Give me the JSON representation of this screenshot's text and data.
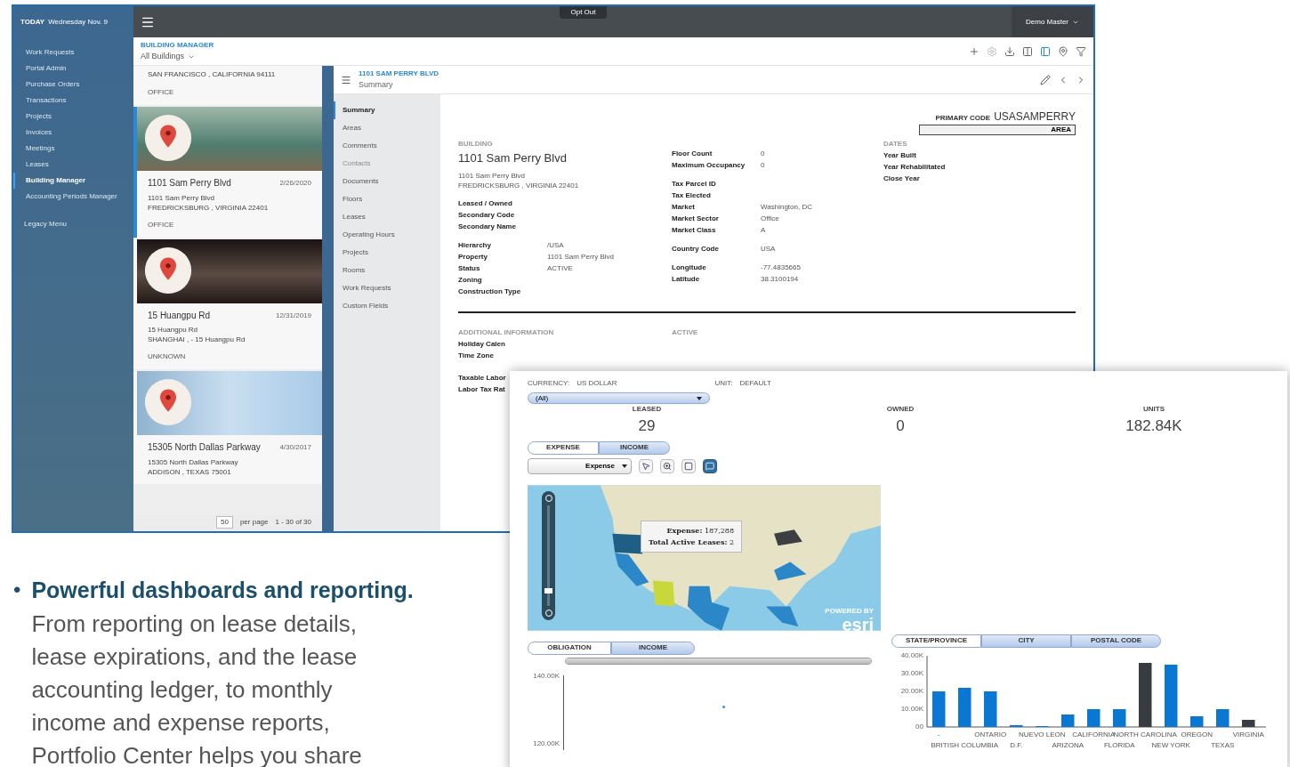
{
  "app": {
    "today_label": "TODAY",
    "date": "Wednesday Nov. 9",
    "opt_out": "Opt Out",
    "user": "Demo Master",
    "nav": [
      {
        "label": "Work Requests",
        "selected": false
      },
      {
        "label": "Portal Admin",
        "selected": false
      },
      {
        "label": "Purchase Orders",
        "selected": false
      },
      {
        "label": "Transactions",
        "selected": false
      },
      {
        "label": "Projects",
        "selected": false
      },
      {
        "label": "Invoices",
        "selected": false
      },
      {
        "label": "Meetings",
        "selected": false
      },
      {
        "label": "Leases",
        "selected": false
      },
      {
        "label": "Building Manager",
        "selected": true
      },
      {
        "label": "Accounting Periods Manager",
        "selected": false
      }
    ],
    "legacy": "Legacy Menu",
    "module": "BUILDING MANAGER",
    "scope": "All Buildings",
    "buildings": [
      {
        "kind": "partial",
        "lines": [
          "SAN FRANCISCO , CALIFORNIA 94111"
        ],
        "type": "OFFICE",
        "selected": false
      },
      {
        "kind": "card",
        "name": "1101 Sam Perry Blvd",
        "date": "2/26/2020",
        "lines": [
          "1101 Sam Perry Blvd",
          "FREDRICKSBURG , VIRGINIA 22401"
        ],
        "type": "OFFICE",
        "selected": true
      },
      {
        "kind": "card",
        "name": "15 Huangpu Rd",
        "date": "12/31/2019",
        "lines": [
          "15 Huangpu Rd",
          "SHANGHAI , - 15 Huangpu Rd"
        ],
        "type": "UNKNOWN",
        "selected": false
      },
      {
        "kind": "card",
        "name": "15305 North Dallas Parkway",
        "date": "4/30/2017",
        "lines": [
          "15305 North Dallas Parkway",
          "ADDISON , TEXAS 75001"
        ],
        "selected": false
      }
    ],
    "pager": {
      "per_page_value": "50",
      "per_page": "per page",
      "range": "1 - 30 of 30"
    },
    "detail": {
      "crumb": "1101 SAM PERRY BLVD",
      "section": "Summary",
      "sections": [
        {
          "label": "Summary",
          "selected": true,
          "disabled": false
        },
        {
          "label": "Areas",
          "selected": false,
          "disabled": false
        },
        {
          "label": "Comments",
          "selected": false,
          "disabled": false
        },
        {
          "label": "Contacts",
          "selected": false,
          "disabled": true
        },
        {
          "label": "Documents",
          "selected": false,
          "disabled": false
        },
        {
          "label": "Floors",
          "selected": false,
          "disabled": false
        },
        {
          "label": "Leases",
          "selected": false,
          "disabled": false
        },
        {
          "label": "Operating Hours",
          "selected": false,
          "disabled": false
        },
        {
          "label": "Projects",
          "selected": false,
          "disabled": false
        },
        {
          "label": "Rooms",
          "selected": false,
          "disabled": false
        },
        {
          "label": "Work Requests",
          "selected": false,
          "disabled": false
        },
        {
          "label": "Custom Fields",
          "selected": false,
          "disabled": false
        }
      ],
      "primary_code_label": "PRIMARY CODE",
      "primary_code": "USASAMPERRY",
      "area_label": "AREA",
      "building_heading": "BUILDING",
      "building_name": "1101 Sam Perry Blvd",
      "address": [
        "1101 Sam Perry Blvd",
        "FREDRICKSBURG , VIRGINIA 22401"
      ],
      "columns": [
        {
          "groups": [
            [
              {
                "label": "Leased / Owned"
              },
              {
                "label": "Secondary Code"
              },
              {
                "label": "Secondary Name"
              }
            ],
            [
              {
                "label": "Hierarchy",
                "value": "/USA"
              },
              {
                "label": "Property",
                "value": "1101 Sam Perry Blvd"
              },
              {
                "label": "Status",
                "value": "ACTIVE"
              },
              {
                "label": "Zoning"
              },
              {
                "label": "Construction Type"
              }
            ]
          ]
        },
        {
          "groups": [
            [
              {
                "label": "Floor Count",
                "value": "0"
              },
              {
                "label": "Maximum Occupancy",
                "value": "0"
              }
            ],
            [
              {
                "label": "Tax Parcel ID"
              },
              {
                "label": "Tax Elected"
              },
              {
                "label": "Market",
                "value": "Washington, DC"
              },
              {
                "label": "Market Sector",
                "value": "Office"
              },
              {
                "label": "Market Class",
                "value": "A"
              }
            ],
            [
              {
                "label": "Country Code",
                "value": "USA"
              }
            ],
            [
              {
                "label": "Longitude",
                "value": "-77.4835665"
              },
              {
                "label": "Latitude",
                "value": "38.3100194"
              }
            ]
          ]
        },
        {
          "heading": "DATES",
          "groups": [
            [
              {
                "label": "Year Built"
              },
              {
                "label": "Year Rehabilitated"
              },
              {
                "label": "Close Year"
              }
            ]
          ]
        }
      ],
      "additional_heading": "ADDITIONAL INFORMATION",
      "active_heading": "ACTIVE",
      "additional": [
        [
          "Holiday Calen",
          "Time Zone"
        ],
        [
          "Taxable Labor",
          "Labor Tax Rat"
        ]
      ]
    }
  },
  "dashboard": {
    "currency_label": "CURRENCY:",
    "currency": "US DOLLAR",
    "unit_label": "UNIT:",
    "unit": "DEFAULT",
    "filter": "(All)",
    "kpis": [
      {
        "label": "LEASED",
        "value": "29"
      },
      {
        "label": "OWNED",
        "value": "0"
      },
      {
        "label": "UNITS",
        "value": "182.84K"
      }
    ],
    "view_tabs": [
      {
        "label": "EXPENSE",
        "selected": true
      },
      {
        "label": "INCOME",
        "selected": false
      }
    ],
    "metric": "Expense",
    "tools": [
      {
        "kind": "pointer",
        "selected": false
      },
      {
        "kind": "zoom",
        "selected": false
      },
      {
        "kind": "extent",
        "selected": false
      },
      {
        "kind": "tooltip",
        "selected": true
      }
    ],
    "tooltip": [
      "**Expense:** 187,288",
      "**Total Active Leases:** 2"
    ],
    "map_zoom": {
      "level": 0.15
    },
    "range_slider": {
      "level": 1
    },
    "attribution": [
      "POWERED BY",
      "esri"
    ],
    "trend_tabs": [
      {
        "label": "OBLIGATION",
        "selected": true
      },
      {
        "label": "INCOME",
        "selected": false
      }
    ],
    "trend": {
      "axis_labels": [
        "140.00K",
        "120.00K"
      ]
    },
    "region_tabs": [
      {
        "label": "STATE/PROVINCE",
        "selected": true
      },
      {
        "label": "CITY",
        "selected": false
      },
      {
        "label": "POSTAL CODE",
        "selected": false
      }
    ],
    "regions": {
      "chart_data": {
        "type": "bar",
        "stacked": true,
        "categories": [
          "-",
          "BRITISH COLUMBIA",
          "ONTARIO",
          "D.F.",
          "NUEVO LEON",
          "ARIZONA",
          "CALIFORNIA",
          "FLORIDA",
          "NORTH CAROLINA",
          "NEW YORK",
          "OREGON",
          "TEXAS",
          "VIRGINIA"
        ],
        "series": [
          {
            "color": "#0a78d2",
            "values": [
              20000,
              22000,
              20000,
              1000,
              500,
              7000,
              10000,
              10000,
              null,
              35000,
              6000,
              10000,
              null
            ]
          },
          {
            "color": "#373c42",
            "values": [
              null,
              null,
              null,
              null,
              null,
              null,
              null,
              null,
              36000,
              null,
              null,
              null,
              4000
            ]
          }
        ],
        "ylim": [
          0,
          40000
        ],
        "yticks": [
          {
            "value": 0,
            "label": "00"
          },
          {
            "value": 10000,
            "label": "10.00K"
          },
          {
            "value": 20000,
            "label": "20.00K"
          },
          {
            "value": 30000,
            "label": "30.00K"
          },
          {
            "value": 40000,
            "label": "40.00K"
          }
        ]
      }
    }
  },
  "copy": {
    "bullet": "•",
    "heading": "Powerful dashboards and reporting.",
    "body": "From reporting on lease details, lease expirations, and the lease accounting ledger, to monthly income and expense reports, Portfolio Center helps you share"
  }
}
